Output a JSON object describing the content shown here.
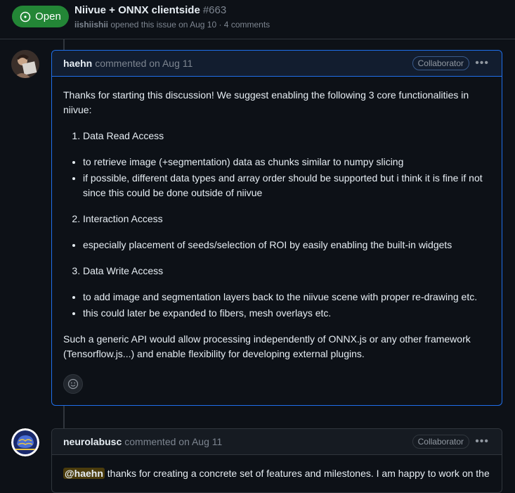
{
  "issue": {
    "status": "Open",
    "title": "Niivue + ONNX clientside",
    "number": "#663",
    "author": "iishiishii",
    "meta_text": "opened this issue on Aug 10 · 4 comments"
  },
  "comments": [
    {
      "author": "haehn",
      "timestamp": "commented on Aug 11",
      "role": "Collaborator",
      "intro": "Thanks for starting this discussion! We suggest enabling the following 3 core functionalities in niivue:",
      "sections": [
        {
          "heading": "Data Read Access",
          "bullets": [
            "to retrieve image (+segmentation) data as chunks similar to numpy slicing",
            "if possible, different data types and array order should be supported but i think it is fine if not since this could be done outside of niivue"
          ]
        },
        {
          "heading": "Interaction Access",
          "bullets": [
            "especially placement of seeds/selection of ROI by easily enabling the built-in widgets"
          ]
        },
        {
          "heading": "Data Write Access",
          "bullets": [
            "to add image and segmentation layers back to the niivue scene with proper re-drawing etc.",
            "this could later be expanded to fibers, mesh overlays etc."
          ]
        }
      ],
      "outro": "Such a generic API would allow processing independently of ONNX.js or any other framework (Tensorflow.js...) and enable flexibility for developing external plugins."
    },
    {
      "author": "neurolabusc",
      "timestamp": "commented on Aug 11",
      "role": "Collaborator",
      "mention": "@haehn",
      "text": " thanks for creating a concrete set of features and milestones. I am happy to work on the"
    }
  ],
  "colors": {
    "open_green": "#238636",
    "border_blue": "#1f6feb",
    "background": "#0d1117"
  }
}
